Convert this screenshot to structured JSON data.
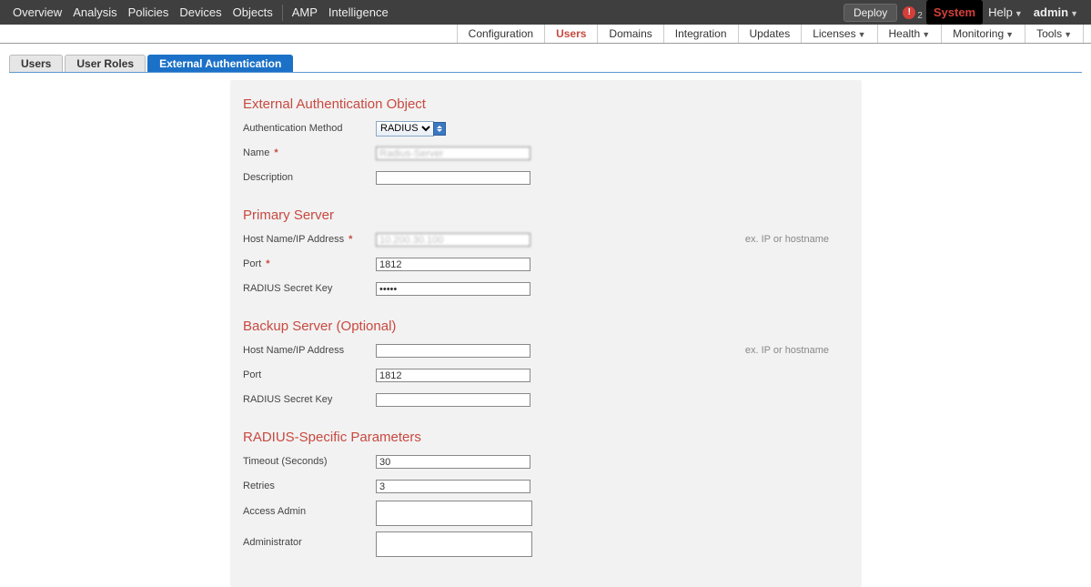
{
  "topnav": {
    "left": [
      "Overview",
      "Analysis",
      "Policies",
      "Devices",
      "Objects"
    ],
    "left2": [
      "AMP",
      "Intelligence"
    ],
    "deploy": "Deploy",
    "alert_count": "2",
    "system": "System",
    "right": [
      "Help",
      "admin"
    ]
  },
  "subnav": {
    "items": [
      {
        "label": "Configuration",
        "dd": false
      },
      {
        "label": "Users",
        "dd": false,
        "active": true
      },
      {
        "label": "Domains",
        "dd": false
      },
      {
        "label": "Integration",
        "dd": false
      },
      {
        "label": "Updates",
        "dd": false
      },
      {
        "label": "Licenses",
        "dd": true
      },
      {
        "label": "Health",
        "dd": true
      },
      {
        "label": "Monitoring",
        "dd": true
      },
      {
        "label": "Tools",
        "dd": true
      }
    ]
  },
  "tertiary": {
    "items": [
      {
        "label": "Users"
      },
      {
        "label": "User Roles"
      },
      {
        "label": "External Authentication",
        "active": true
      }
    ]
  },
  "form": {
    "ext_auth_title": "External Authentication Object",
    "auth_method_label": "Authentication Method",
    "auth_method_value": "RADIUS",
    "name_label": "Name",
    "name_value": "Radius-Server",
    "desc_label": "Description",
    "desc_value": "",
    "primary_title": "Primary Server",
    "host_label": "Host Name/IP Address",
    "primary_host_value": "10.200.30.100",
    "port_label": "Port",
    "primary_port_value": "1812",
    "secret_label": "RADIUS Secret Key",
    "primary_secret_value": "•••••",
    "host_hint": "ex. IP or hostname",
    "backup_title": "Backup Server (Optional)",
    "backup_host_value": "",
    "backup_port_value": "1812",
    "backup_secret_value": "",
    "radius_params_title": "RADIUS-Specific Parameters",
    "timeout_label": "Timeout (Seconds)",
    "timeout_value": "30",
    "retries_label": "Retries",
    "retries_value": "3",
    "access_admin_label": "Access Admin",
    "administrator_label": "Administrator"
  }
}
